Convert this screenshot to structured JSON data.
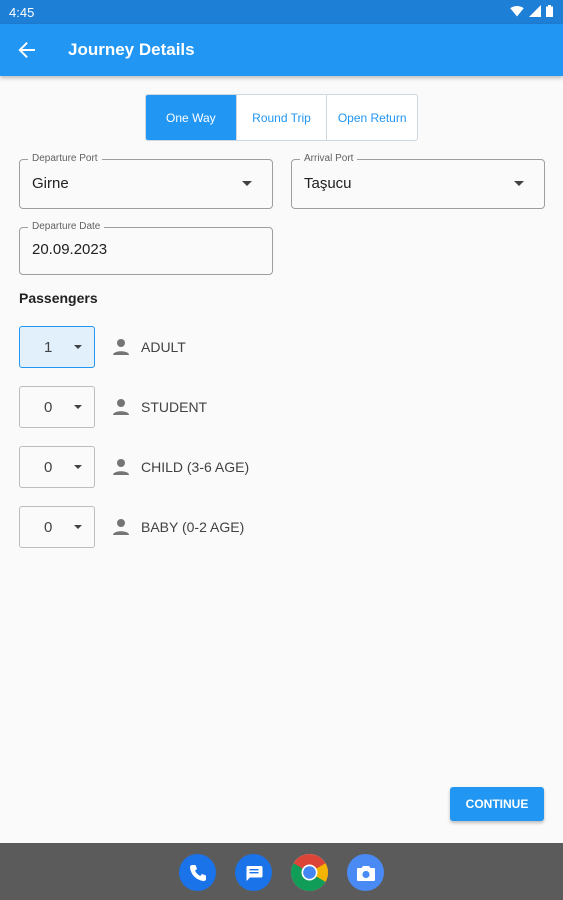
{
  "status_bar": {
    "time": "4:45"
  },
  "app_bar": {
    "title": "Journey Details"
  },
  "trip_type": {
    "options": [
      "One Way",
      "Round Trip",
      "Open Return"
    ],
    "selected": "One Way"
  },
  "departure_port": {
    "label": "Departure Port",
    "value": "Girne"
  },
  "arrival_port": {
    "label": "Arrival Port",
    "value": "Taşucu"
  },
  "departure_date": {
    "label": "Departure Date",
    "value": "20.09.2023"
  },
  "passengers": {
    "title": "Passengers",
    "rows": [
      {
        "count": "1",
        "label": "ADULT"
      },
      {
        "count": "0",
        "label": "STUDENT"
      },
      {
        "count": "0",
        "label": "CHILD (3-6 AGE)"
      },
      {
        "count": "0",
        "label": "BABY (0-2 AGE)"
      }
    ]
  },
  "continue_label": "CONTINUE",
  "colors": {
    "primary": "#2196f3",
    "status_bar": "#1e7fd6",
    "dock": "#5b5b5b"
  },
  "dock_apps": [
    "phone-icon",
    "messages-icon",
    "chrome-icon",
    "camera-icon"
  ]
}
